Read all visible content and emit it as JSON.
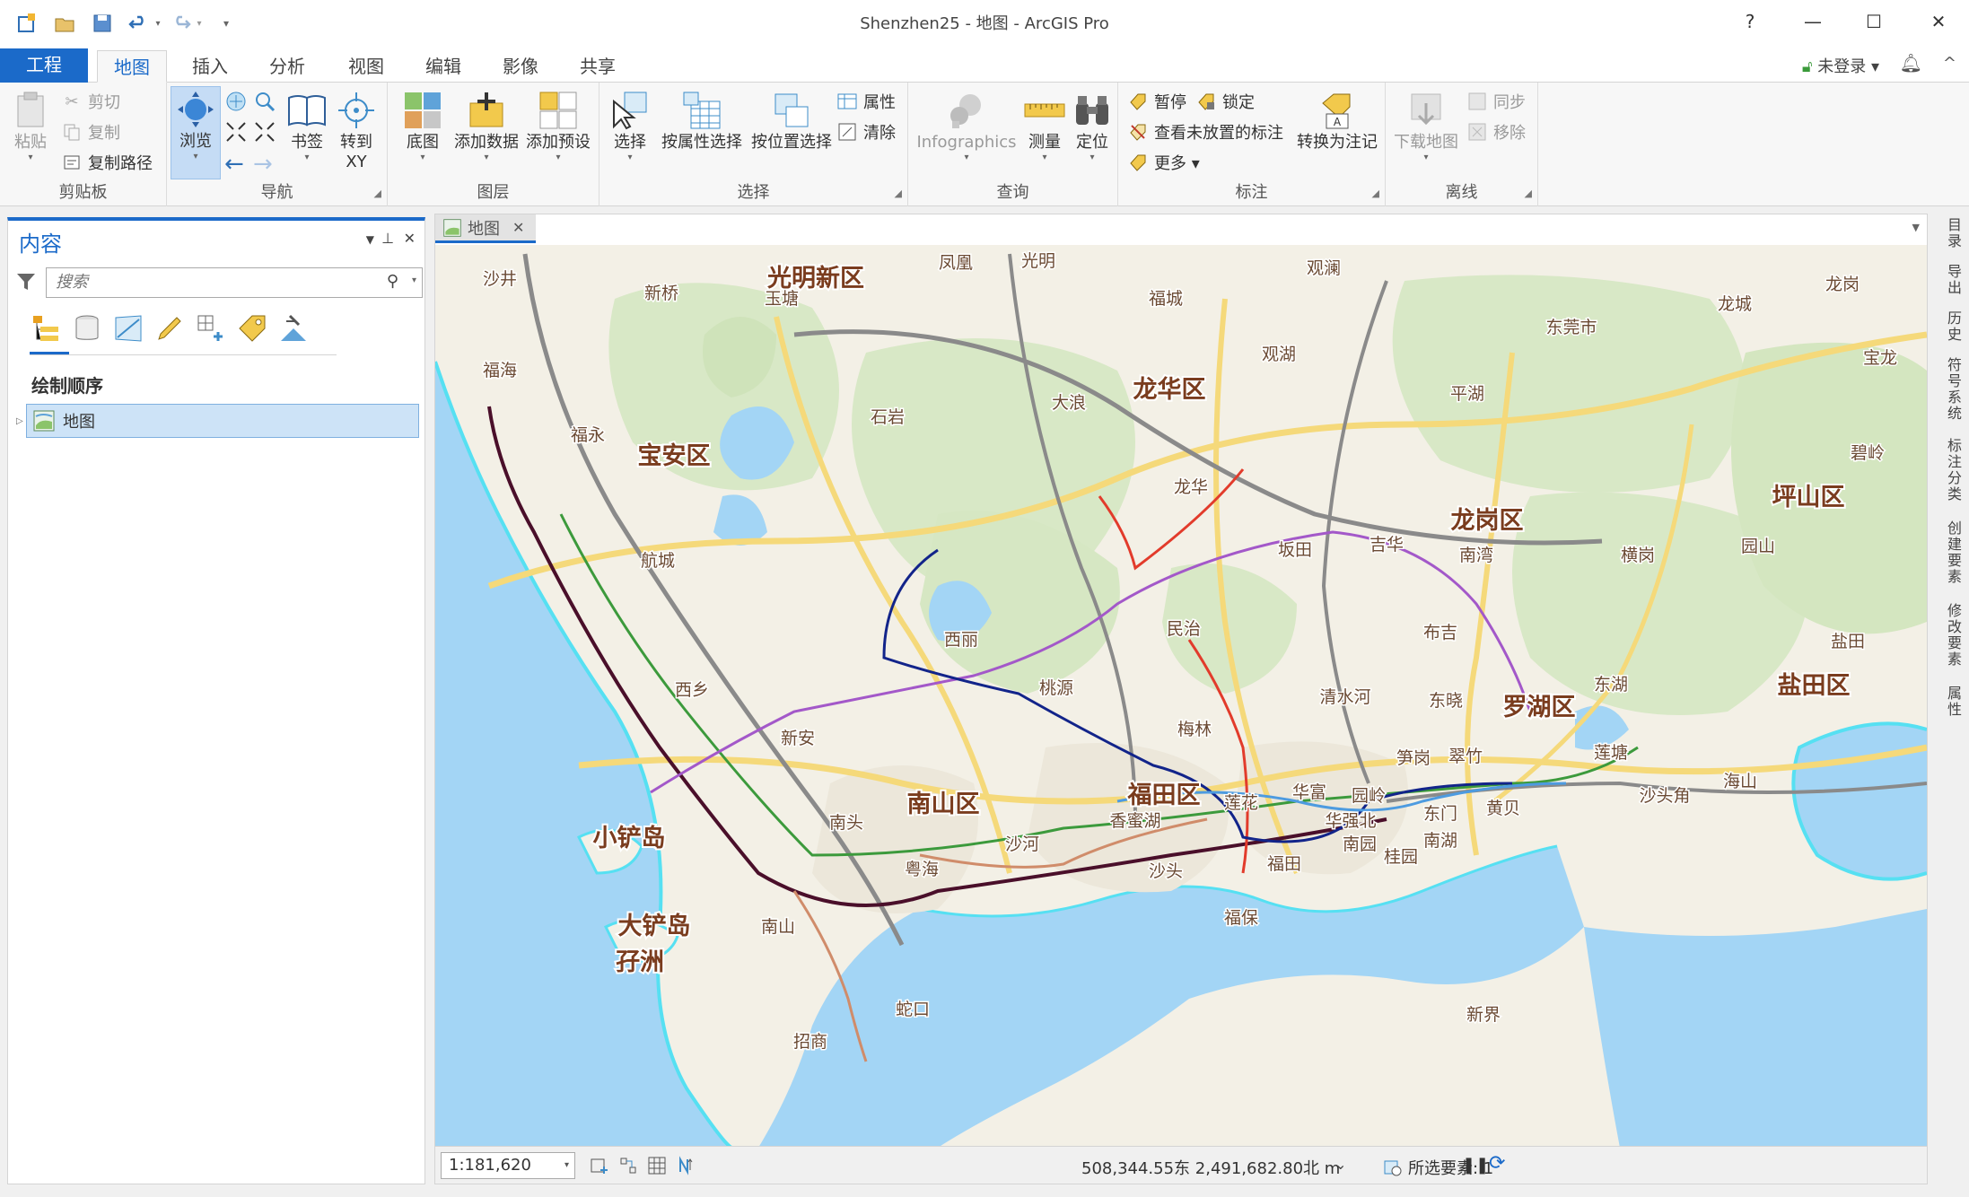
{
  "window": {
    "title": "Shenzhen25 - 地图 - ArcGIS Pro",
    "help": "?",
    "minimize": "—",
    "maximize": "☐",
    "close": "✕"
  },
  "tabs": [
    {
      "label": "工程"
    },
    {
      "label": "地图"
    },
    {
      "label": "插入"
    },
    {
      "label": "分析"
    },
    {
      "label": "视图"
    },
    {
      "label": "编辑"
    },
    {
      "label": "影像"
    },
    {
      "label": "共享"
    }
  ],
  "user": {
    "label": "未登录 ▾"
  },
  "ribbon": {
    "clipboard": {
      "label": "剪贴板",
      "paste": "粘贴",
      "cut": "剪切",
      "copy": "复制",
      "copy_path": "复制路径"
    },
    "navigate": {
      "label": "导航",
      "explore": "浏览",
      "bookmarks": "书签",
      "goto_xy_1": "转到",
      "goto_xy_2": "XY"
    },
    "layer": {
      "label": "图层",
      "basemap": "底图",
      "add_data": "添加数据",
      "add_preset": "添加预设"
    },
    "selection": {
      "label": "选择",
      "select": "选择",
      "by_attributes": "按属性选择",
      "by_location": "按位置选择",
      "attributes": "属性",
      "clear": "清除"
    },
    "inquiry": {
      "label": "查询",
      "infographics": "Infographics",
      "measure": "测量",
      "locate": "定位"
    },
    "labeling": {
      "label": "标注",
      "pause": "暂停",
      "lock": "锁定",
      "view_unplaced": "查看未放置的标注",
      "more": "更多 ▾",
      "convert": "转换为注记"
    },
    "offline": {
      "label": "离线",
      "download": "下载地图",
      "sync": "同步",
      "remove": "移除"
    }
  },
  "contents": {
    "title": "内容",
    "search_placeholder": "搜索",
    "drawing_order": "绘制顺序",
    "map_node": "地图"
  },
  "map_view": {
    "tab_label": "地图",
    "labels": {
      "districts": [
        "光明新区",
        "宝安区",
        "龙华区",
        "南山区",
        "福田区",
        "罗湖区",
        "龙岗区",
        "坪山区",
        "盐田区"
      ],
      "islands": [
        "小铲岛",
        "大铲岛",
        "孖洲"
      ],
      "places": [
        "沙井",
        "新桥",
        "玉塘",
        "凤凰",
        "光明",
        "福城",
        "观澜",
        "龙岗",
        "龙城",
        "东莞市",
        "宝龙",
        "福海",
        "福永",
        "石岩",
        "大浪",
        "观湖",
        "平湖",
        "碧岭",
        "龙华",
        "航城",
        "坂田",
        "吉华",
        "南湾",
        "横岗",
        "园山",
        "西丽",
        "民治",
        "布吉",
        "东湖",
        "盐田",
        "西乡",
        "桃源",
        "清水河",
        "东晓",
        "新安",
        "梅林",
        "笋岗",
        "翠竹",
        "莲塘",
        "海山",
        "沙头角",
        "南头",
        "莲花",
        "华富",
        "园岭",
        "东门",
        "黄贝",
        "香蜜湖",
        "华强北",
        "沙河",
        "南园",
        "南湖",
        "粤海",
        "桂园",
        "福田",
        "沙头",
        "南山",
        "福保",
        "蛇口",
        "新界",
        "招商"
      ]
    }
  },
  "status": {
    "scale": "1:181,620",
    "coordinates": "508,344.55东 2,491,682.80北 m",
    "selected": "所选要素: 1"
  },
  "dock_tabs": [
    "目录",
    "导出",
    "历史",
    "符号系统",
    "标注分类",
    "创建要素",
    "修改要素",
    "属性"
  ],
  "colors": {
    "accent": "#1b6ac9",
    "water": "#a3d5f5",
    "land": "#f3f0e6",
    "green": "#d8e8c6",
    "highway": "#f5d97a",
    "district_label": "#7a3c1e"
  }
}
